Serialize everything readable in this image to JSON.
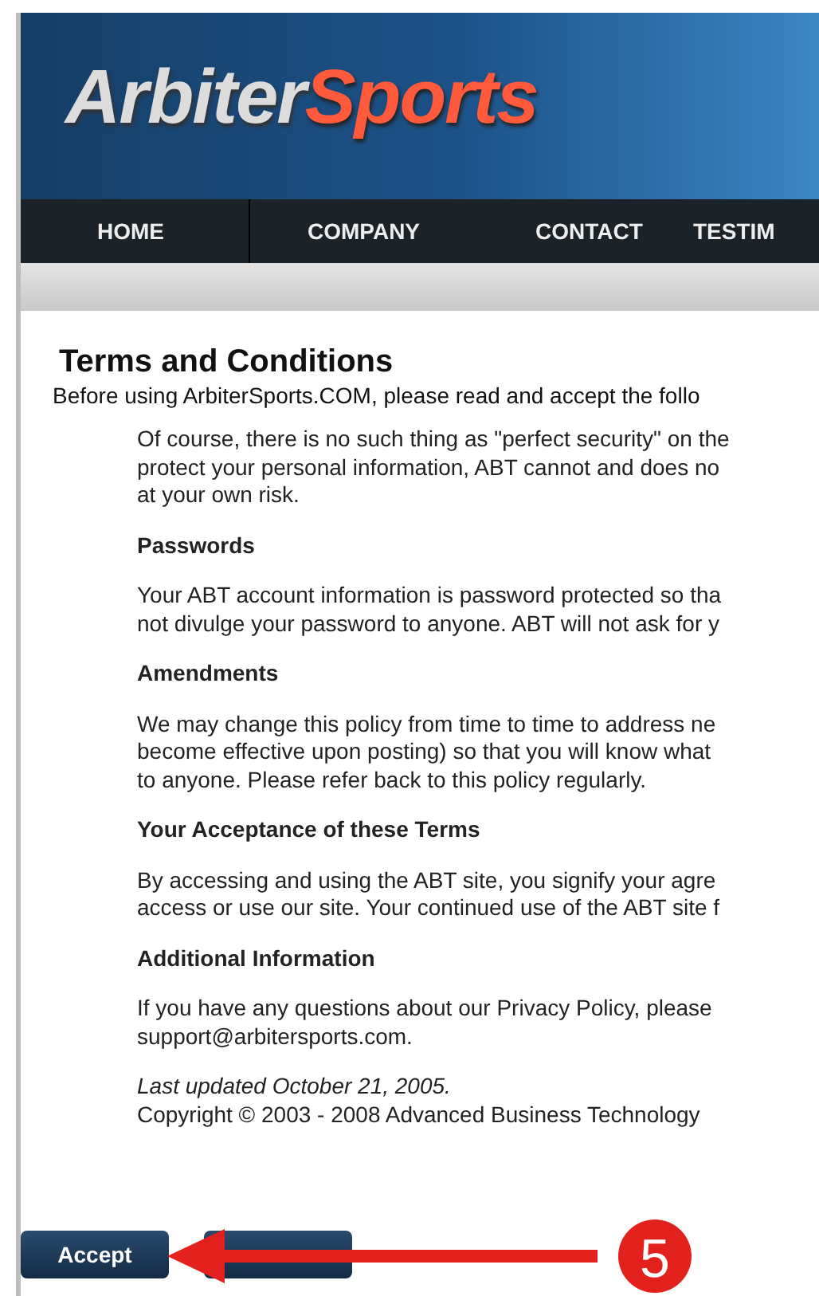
{
  "logo": {
    "part_1": "Arbiter",
    "part_2": "Sports"
  },
  "nav": [
    {
      "label": "HOME"
    },
    {
      "label": "COMPANY"
    },
    {
      "label": "CONTACT"
    },
    {
      "label": "TESTIM"
    }
  ],
  "title": "Terms and Conditions",
  "intro": "Before using ArbiterSports.COM, please read and accept the follo",
  "sections": [
    {
      "kind": "text",
      "lines": [
        "Of course, there is no such thing as \"perfect security\" on the",
        "protect your personal information, ABT cannot and does no",
        "at your own risk."
      ]
    },
    {
      "kind": "heading",
      "lines": [
        "Passwords"
      ]
    },
    {
      "kind": "text",
      "lines": [
        "Your ABT account information is password protected so tha",
        "not divulge your password to anyone. ABT will not ask for y"
      ]
    },
    {
      "kind": "heading",
      "lines": [
        "Amendments"
      ]
    },
    {
      "kind": "text",
      "lines": [
        "We may change this policy from time to time to address ne",
        "become effective upon posting) so that you will know what",
        "to anyone. Please refer back to this policy regularly."
      ]
    },
    {
      "kind": "heading",
      "lines": [
        "Your Acceptance of these Terms"
      ]
    },
    {
      "kind": "text",
      "lines": [
        "By accessing and using the ABT site, you signify your agre",
        "access or use our site. Your continued use of the ABT site f"
      ]
    },
    {
      "kind": "heading",
      "lines": [
        "Additional Information"
      ]
    },
    {
      "kind": "text",
      "lines": [
        "If you have any questions about our Privacy Policy, please",
        "support@arbitersports.com."
      ]
    },
    {
      "kind": "footer",
      "lines": [
        "Last updated October 21, 2005.",
        "Copyright © 2003 - 2008 Advanced Business Technology"
      ]
    }
  ],
  "buttons": [
    {
      "kind": "labeled",
      "label": "Accept"
    },
    {
      "kind": "covered"
    }
  ],
  "callout": {
    "step": "5"
  }
}
